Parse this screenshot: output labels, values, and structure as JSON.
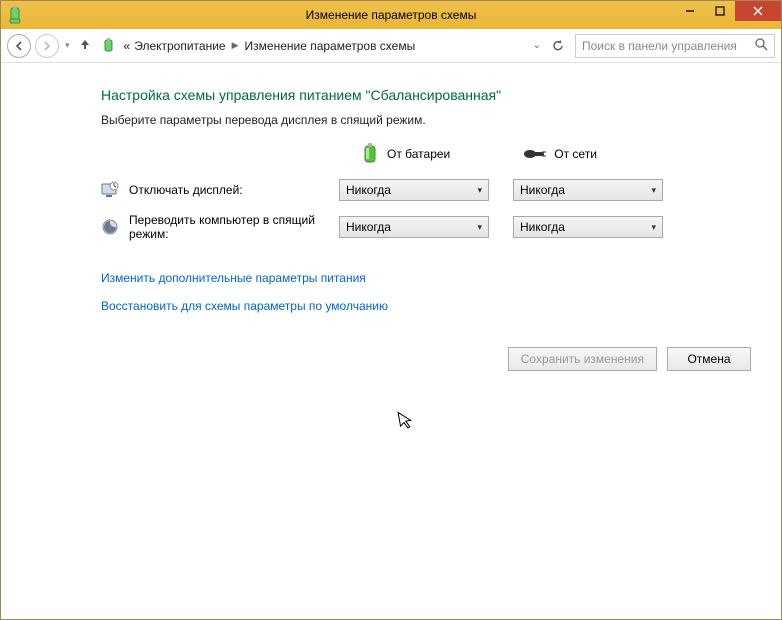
{
  "window": {
    "title": "Изменение параметров схемы"
  },
  "breadcrumb": {
    "prefix": "«",
    "item1": "Электропитание",
    "item2": "Изменение параметров схемы"
  },
  "search": {
    "placeholder": "Поиск в панели управления"
  },
  "page": {
    "heading": "Настройка схемы управления питанием \"Сбалансированная\"",
    "subtext": "Выберите параметры перевода дисплея в спящий режим."
  },
  "columns": {
    "battery": "От батареи",
    "plugged": "От сети"
  },
  "rows": {
    "display_off": {
      "label": "Отключать дисплей:",
      "battery_value": "Никогда",
      "plugged_value": "Никогда"
    },
    "sleep": {
      "label": "Переводить компьютер в спящий режим:",
      "battery_value": "Никогда",
      "plugged_value": "Никогда"
    }
  },
  "links": {
    "advanced": "Изменить дополнительные параметры питания",
    "restore": "Восстановить для схемы параметры по умолчанию"
  },
  "buttons": {
    "save": "Сохранить изменения",
    "cancel": "Отмена"
  }
}
